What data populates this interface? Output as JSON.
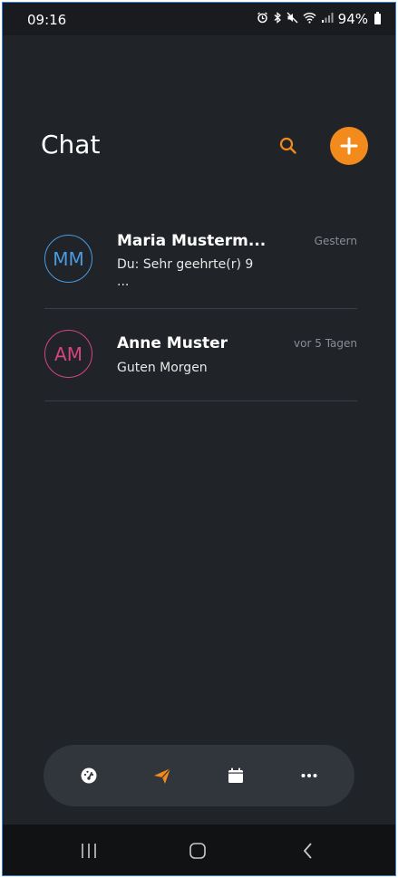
{
  "status_bar": {
    "time": "09:16",
    "battery_percent": "94%",
    "icons": [
      "alarm-icon",
      "bluetooth-icon",
      "mute-icon",
      "wifi-icon",
      "signal-icon",
      "battery-icon"
    ]
  },
  "header": {
    "title": "Chat",
    "search_icon": "search-icon",
    "add_icon": "plus-icon"
  },
  "chats": [
    {
      "initials": "MM",
      "name": "Maria Musterm...",
      "time": "Gestern",
      "preview_line1": "Du: Sehr geehrte(r) 9",
      "preview_line2": "...",
      "avatar_color": "#4a9be0"
    },
    {
      "initials": "AM",
      "name": "Anne Muster",
      "time": "vor 5 Tagen",
      "preview_line1": "Guten Morgen",
      "preview_line2": "",
      "avatar_color": "#d6457f"
    }
  ],
  "bottom_nav": {
    "items": [
      "dashboard-icon",
      "send-icon",
      "calendar-icon",
      "more-icon"
    ],
    "active_index": 1
  },
  "colors": {
    "accent": "#f28a1c",
    "background": "#202328",
    "nav_bg": "#31353c"
  }
}
